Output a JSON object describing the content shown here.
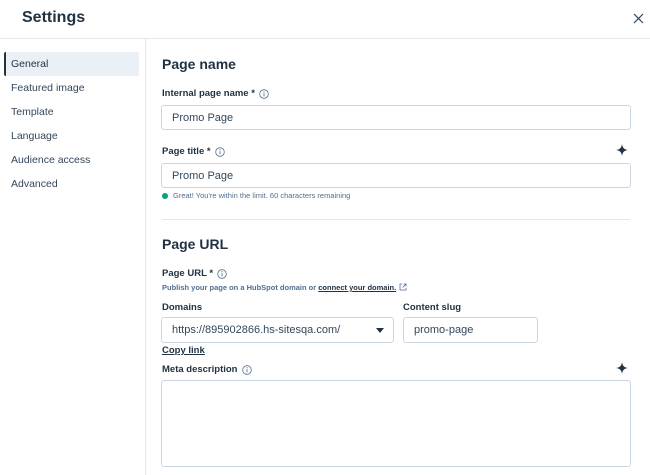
{
  "header": {
    "title": "Settings"
  },
  "sidebar": {
    "items": [
      {
        "label": "General"
      },
      {
        "label": "Featured image"
      },
      {
        "label": "Template"
      },
      {
        "label": "Language"
      },
      {
        "label": "Audience access"
      },
      {
        "label": "Advanced"
      }
    ]
  },
  "page_name": {
    "section_title": "Page name",
    "internal_label": "Internal page name *",
    "internal_value": "Promo Page",
    "title_label": "Page title *",
    "title_value": "Promo Page",
    "status_text": "Great! You're within the limit. 60 characters remaining"
  },
  "page_url": {
    "section_title": "Page URL",
    "url_label": "Page URL *",
    "hint_text": "Publish your page on a HubSpot domain or",
    "hint_link": "connect your domain.",
    "domains_label": "Domains",
    "domain_value": "https://895902866.hs-sitesqa.com/",
    "slug_label": "Content slug",
    "slug_value": "promo-page",
    "copy_link": "Copy link"
  },
  "meta": {
    "label": "Meta description",
    "value": ""
  },
  "colors": {
    "accent": "#213343",
    "success": "#00a47c",
    "border": "#cbd6e2",
    "active_bg": "#eaf0f6"
  },
  "icons": {
    "close": "close-icon",
    "info": "info-icon",
    "sparkle": "sparkle-icon",
    "external": "external-link-icon",
    "caret": "chevron-down-icon"
  }
}
